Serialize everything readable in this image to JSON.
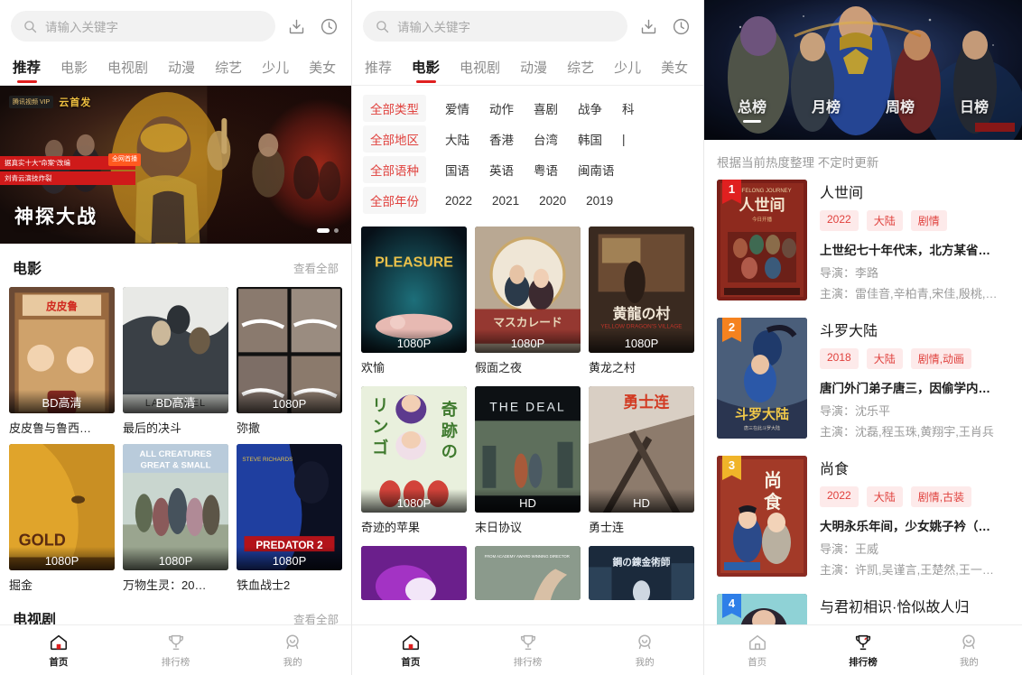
{
  "search": {
    "placeholder": "请输入关键字",
    "icons": [
      "search-icon",
      "download-icon",
      "history-icon"
    ]
  },
  "tabs": {
    "items": [
      "推荐",
      "电影",
      "电视剧",
      "动漫",
      "综艺",
      "少儿",
      "美女"
    ],
    "panel1_active": "推荐",
    "panel2_active": "电影"
  },
  "panel1": {
    "banner": {
      "title": "神探大战",
      "vip_tag": "腾讯视频 VIP",
      "promo": "云首发",
      "strip1": "据真实十大\"命案\"改编",
      "strip2": "刘青云演技炸裂",
      "corner": "全网首播"
    },
    "sections": [
      {
        "title": "电影",
        "more": "查看全部",
        "cards": [
          {
            "title": "皮皮鲁与鲁西…",
            "quality": "BD高清"
          },
          {
            "title": "最后的决斗",
            "quality": "BD高清"
          },
          {
            "title": "弥撒",
            "quality": "1080P"
          },
          {
            "title": "掘金",
            "quality": "1080P"
          },
          {
            "title": "万物生灵：20…",
            "quality": "1080P"
          },
          {
            "title": "铁血战士2",
            "quality": "1080P"
          }
        ]
      },
      {
        "title": "电视剧",
        "more": "查看全部",
        "cards": []
      }
    ]
  },
  "panel2": {
    "filters": [
      {
        "key": "全部类型",
        "options": [
          "爱情",
          "动作",
          "喜剧",
          "战争",
          "科"
        ]
      },
      {
        "key": "全部地区",
        "options": [
          "大陆",
          "香港",
          "台湾",
          "韩国",
          "|"
        ]
      },
      {
        "key": "全部语种",
        "options": [
          "国语",
          "英语",
          "粤语",
          "闽南语"
        ]
      },
      {
        "key": "全部年份",
        "options": [
          "2022",
          "2021",
          "2020",
          "2019"
        ]
      }
    ],
    "cards": [
      {
        "title": "欢愉",
        "quality": "1080P"
      },
      {
        "title": "假面之夜",
        "quality": "1080P"
      },
      {
        "title": "黄龙之村",
        "quality": "1080P"
      },
      {
        "title": "奇迹的苹果",
        "quality": "1080P"
      },
      {
        "title": "末日协议",
        "quality": "HD"
      },
      {
        "title": "勇士连",
        "quality": "HD"
      },
      {
        "title": "",
        "quality": ""
      },
      {
        "title": "",
        "quality": ""
      },
      {
        "title": "",
        "quality": ""
      }
    ]
  },
  "panel3": {
    "rank_tabs": [
      "总榜",
      "月榜",
      "周榜",
      "日榜"
    ],
    "rank_tab_active": "总榜",
    "subtitle": "根据当前热度整理 不定时更新",
    "items": [
      {
        "rank": "1",
        "badge_color": "#e02020",
        "name": "人世间",
        "tags": [
          "2022",
          "大陆",
          "剧情"
        ],
        "desc": "上世纪七十年代末，北方某省…",
        "director": "导演：李路",
        "cast": "主演：雷佳音,辛柏青,宋佳,殷桃,…"
      },
      {
        "rank": "2",
        "badge_color": "#f5821f",
        "name": "斗罗大陆",
        "tags": [
          "2018",
          "大陆",
          "剧情,动画"
        ],
        "desc": "唐门外门弟子唐三，因偷学内…",
        "director": "导演：沈乐平",
        "cast": "主演：沈磊,程玉珠,黄翔宇,王肖兵"
      },
      {
        "rank": "3",
        "badge_color": "#f0b429",
        "name": "尚食",
        "tags": [
          "2022",
          "大陆",
          "剧情,古装"
        ],
        "desc": "大明永乐年间，少女姚子衿（…",
        "director": "导演：王威",
        "cast": "主演：许凯,吴谨言,王楚然,王一…"
      },
      {
        "rank": "4",
        "badge_color": "#2f7fe8",
        "name": "与君初相识·恰似故人归",
        "tags": [],
        "desc": "",
        "director": "",
        "cast": ""
      }
    ]
  },
  "bottomnav": {
    "items": [
      {
        "label": "首页",
        "icon": "home-icon"
      },
      {
        "label": "排行榜",
        "icon": "trophy-icon"
      },
      {
        "label": "我的",
        "icon": "user-icon"
      }
    ],
    "panel1_active": "首页",
    "panel2_active": "首页",
    "panel3_active": "排行榜"
  },
  "colors": {
    "accent": "#e02020",
    "tag_bg": "#fdeaea",
    "muted": "#9b9b9b"
  }
}
